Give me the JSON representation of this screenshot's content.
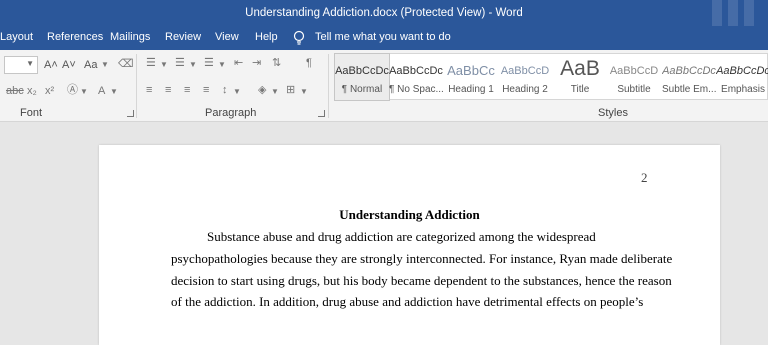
{
  "window": {
    "title": "Understanding Addiction.docx (Protected View) - Word"
  },
  "tabs": [
    "Layout",
    "References",
    "Mailings",
    "Review",
    "View",
    "Help"
  ],
  "tell_me": "Tell me what you want to do",
  "ribbon": {
    "font_group": "Font",
    "paragraph_group": "Paragraph",
    "styles_group": "Styles",
    "font_controls": {
      "grow": "A˄",
      "shrink": "A˅",
      "case": "Aa",
      "strike": "abc",
      "subscript": "x₂",
      "superscript": "x²",
      "font_color": "A"
    }
  },
  "styles": [
    {
      "sample": "AaBbCcDc",
      "name": "¶ Normal"
    },
    {
      "sample": "AaBbCcDc",
      "name": "¶ No Spac..."
    },
    {
      "sample": "AaBbCc",
      "name": "Heading 1"
    },
    {
      "sample": "AaBbCcD",
      "name": "Heading 2"
    },
    {
      "sample": "AaB",
      "name": "Title"
    },
    {
      "sample": "AaBbCcD",
      "name": "Subtitle"
    },
    {
      "sample": "AaBbCcDc",
      "name": "Subtle Em..."
    },
    {
      "sample": "AaBbCcDc",
      "name": "Emphasis"
    }
  ],
  "document": {
    "page_number": "2",
    "title": "Understanding Addiction",
    "lines": [
      "Substance abuse and drug addiction are categorized among the widespread",
      "psychopathologies because they are strongly interconnected. For instance, Ryan made deliberate",
      "decision to start using drugs, but his body became dependent to the substances, hence the reason",
      "of the addiction. In addition, drug abuse and addiction have detrimental effects on people’s"
    ]
  },
  "colors": {
    "titlebar": "#2b579a",
    "ribbon": "#f3f3f3",
    "workspace": "#e6e6e6"
  }
}
